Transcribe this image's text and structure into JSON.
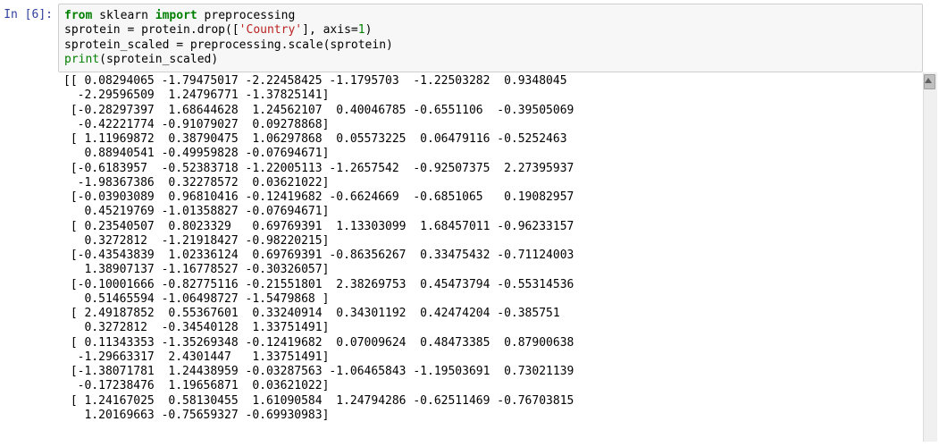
{
  "prompt": {
    "in_label": "In [6]:"
  },
  "code": {
    "line1_kw_from": "from",
    "line1_mod": " sklearn ",
    "line1_kw_import": "import",
    "line1_rest": " preprocessing",
    "line2_pre": "sprotein = protein.drop([",
    "line2_str": "'Country'",
    "line2_mid": "], axis=",
    "line2_num": "1",
    "line2_end": ")",
    "line3": "sprotein_scaled = preprocessing.scale(sprotein)",
    "line4_pre": "print",
    "line4_args": "(sprotein_scaled)"
  },
  "output_lines": [
    "[[ 0.08294065 -1.79475017 -2.22458425 -1.1795703  -1.22503282  0.9348045",
    "  -2.29596509  1.24796771 -1.37825141]",
    " [-0.28297397  1.68644628  1.24562107  0.40046785 -0.6551106  -0.39505069",
    "  -0.42221774 -0.91079027  0.09278868]",
    " [ 1.11969872  0.38790475  1.06297868  0.05573225  0.06479116 -0.5252463",
    "   0.88940541 -0.49959828 -0.07694671]",
    " [-0.6183957  -0.52383718 -1.22005113 -1.2657542  -0.92507375  2.27395937",
    "  -1.98367386  0.32278572  0.03621022]",
    " [-0.03903089  0.96810416 -0.12419682 -0.6624669  -0.6851065   0.19082957",
    "   0.45219769 -1.01358827 -0.07694671]",
    " [ 0.23540507  0.8023329   0.69769391  1.13303099  1.68457011 -0.96233157",
    "   0.3272812  -1.21918427 -0.98220215]",
    " [-0.43543839  1.02336124  0.69769391 -0.86356267  0.33475432 -0.71124003",
    "   1.38907137 -1.16778527 -0.30326057]",
    " [-0.10001666 -0.82775116 -0.21551801  2.38269753  0.45473794 -0.55314536",
    "   0.51465594 -1.06498727 -1.5479868 ]",
    " [ 2.49187852  0.55367601  0.33240914  0.34301192  0.42474204 -0.385751",
    "   0.3272812  -0.34540128  1.33751491]",
    " [ 0.11343353 -1.35269348 -0.12419682  0.07009624  0.48473385  0.87900638",
    "  -1.29663317  2.4301447   1.33751491]",
    " [-1.38071781  1.24438959 -0.03287563 -1.06465843 -1.19503691  0.73021139",
    "  -0.17238476  1.19656871  0.03621022]",
    " [ 1.24167025  0.58130455  1.61090584  1.24794286 -0.62511469 -0.76703815",
    "   1.20169663 -0.75659327 -0.69930983]"
  ]
}
